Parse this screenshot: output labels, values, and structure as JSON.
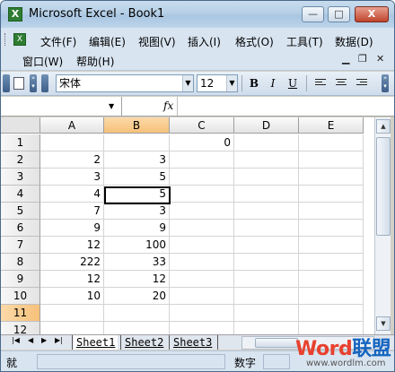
{
  "window": {
    "title": "Microsoft Excel - Book1",
    "icon": "excel-icon",
    "min_label": "—",
    "max_label": "□",
    "close_label": "X"
  },
  "menu": {
    "items": [
      "文件(F)",
      "编辑(E)",
      "视图(V)",
      "插入(I)",
      "格式(O)",
      "工具(T)",
      "数据(D)"
    ],
    "items_row2": [
      "窗口(W)",
      "帮助(H)"
    ],
    "doc_controls": [
      "▾",
      "×",
      "🗗",
      "×"
    ]
  },
  "toolbar": {
    "font_name": "宋体",
    "font_size": "12",
    "bold": "B",
    "italic": "I",
    "underline": "U"
  },
  "formula": {
    "name_box": "",
    "fx_label": "fx",
    "value": ""
  },
  "sheet": {
    "columns": [
      "A",
      "B",
      "C",
      "D",
      "E"
    ],
    "selected_column": "B",
    "rows": [
      {
        "num": "1",
        "A": "",
        "B": "",
        "C": "0",
        "D": "",
        "E": ""
      },
      {
        "num": "2",
        "A": "2",
        "B": "3",
        "C": "",
        "D": "",
        "E": ""
      },
      {
        "num": "3",
        "A": "3",
        "B": "5",
        "C": "",
        "D": "",
        "E": ""
      },
      {
        "num": "4",
        "A": "4",
        "B": "5",
        "C": "",
        "D": "",
        "E": ""
      },
      {
        "num": "5",
        "A": "7",
        "B": "3",
        "C": "",
        "D": "",
        "E": ""
      },
      {
        "num": "6",
        "A": "9",
        "B": "9",
        "C": "",
        "D": "",
        "E": ""
      },
      {
        "num": "7",
        "A": "12",
        "B": "100",
        "C": "",
        "D": "",
        "E": ""
      },
      {
        "num": "8",
        "A": "222",
        "B": "33",
        "C": "",
        "D": "",
        "E": ""
      },
      {
        "num": "9",
        "A": "12",
        "B": "12",
        "C": "",
        "D": "",
        "E": ""
      },
      {
        "num": "10",
        "A": "10",
        "B": "20",
        "C": "",
        "D": "",
        "E": ""
      },
      {
        "num": "11",
        "A": "",
        "B": "",
        "C": "",
        "D": "",
        "E": ""
      },
      {
        "num": "12",
        "A": "",
        "B": "",
        "C": "",
        "D": "",
        "E": ""
      }
    ],
    "selected_row": "11"
  },
  "tabs": {
    "sheets": [
      "Sheet1",
      "Sheet2",
      "Sheet3"
    ],
    "active": "Sheet1"
  },
  "status": {
    "left": "就",
    "mode": "数字"
  },
  "watermark": {
    "word": "Word",
    "cn": "联盟",
    "url": "www.wordlm.com"
  }
}
